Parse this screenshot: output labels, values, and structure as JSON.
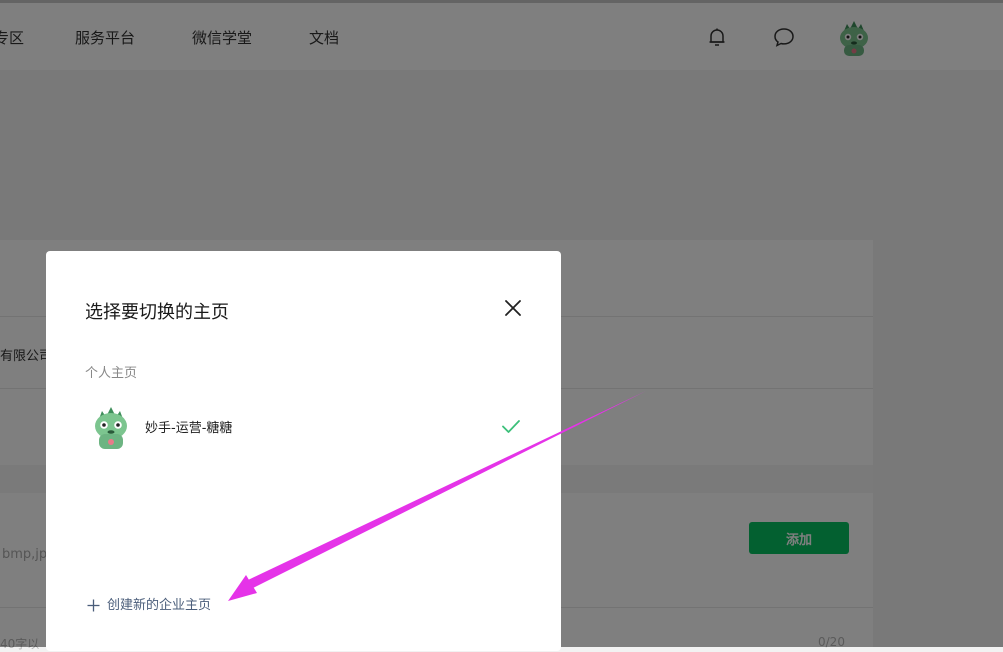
{
  "nav": {
    "items": [
      {
        "label": "专区",
        "name": "nav-item-zone"
      },
      {
        "label": "服务平台",
        "name": "nav-item-service-platform"
      },
      {
        "label": "微信学堂",
        "name": "nav-item-wechat-academy"
      },
      {
        "label": "文档",
        "name": "nav-item-docs"
      }
    ],
    "icons": {
      "bell": "bell-icon",
      "message": "message-icon"
    }
  },
  "background": {
    "company_text": "有限公司",
    "file_hint": "bmp,jp",
    "add_button_label": "添加",
    "char_hint": "40字以",
    "char_count": "0/20"
  },
  "modal": {
    "title": "选择要切换的主页",
    "section_label": "个人主页",
    "account": {
      "name": "妙手-运营-糖糖",
      "selected": true
    },
    "create_label": "创建新的企业主页"
  },
  "colors": {
    "accent_green": "#07c160",
    "check_green": "#3cc07a",
    "annotation_magenta": "#e533e8",
    "overlay": "rgba(0,0,0,0.5)"
  }
}
